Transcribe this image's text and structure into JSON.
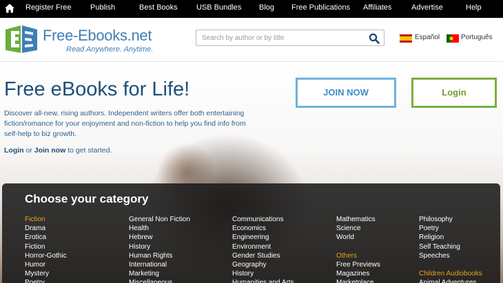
{
  "topnav": {
    "items": [
      "Register Free",
      "Publish",
      "Best Books",
      "USB Bundles",
      "Blog",
      "Free Publications",
      "Affiliates",
      "Advertise",
      "Help"
    ]
  },
  "header": {
    "logo_text": "Free-Ebooks.net",
    "logo_tagline": "Read Anywhere. Anytime.",
    "search_placeholder": "Search by author or by title",
    "languages": [
      "Español",
      "Português"
    ]
  },
  "hero": {
    "title": "Free eBooks for Life!",
    "description": "Discover all-new, rising authors. Independent writers offer both entertaining fiction/romance for your enjoyment and non-fiction to help you find info from self-help to biz growth.",
    "cta_login": "Login",
    "cta_or": " or ",
    "cta_join": "Join now",
    "cta_rest": " to get started.",
    "join_button": "JOIN NOW",
    "login_button": "Login"
  },
  "categories": {
    "heading": "Choose your category",
    "col1": [
      {
        "text": "Fiction",
        "heading": true
      },
      {
        "text": "Drama"
      },
      {
        "text": "Erotica"
      },
      {
        "text": "Fiction"
      },
      {
        "text": "Horror-Gothic"
      },
      {
        "text": "Humor"
      },
      {
        "text": "Mystery"
      },
      {
        "text": "Poetry"
      }
    ],
    "col2": [
      {
        "text": "General Non Fiction"
      },
      {
        "text": "Health"
      },
      {
        "text": "Hebrew"
      },
      {
        "text": "History"
      },
      {
        "text": "Human Rights"
      },
      {
        "text": "International"
      },
      {
        "text": "Marketing"
      },
      {
        "text": "Miscellaneous"
      }
    ],
    "col3": [
      {
        "text": "Communications"
      },
      {
        "text": "Economics"
      },
      {
        "text": "Engineering"
      },
      {
        "text": "Environment"
      },
      {
        "text": "Gender Studies"
      },
      {
        "text": "Geography"
      },
      {
        "text": "History"
      },
      {
        "text": "Humanities and Arts"
      }
    ],
    "col4": [
      {
        "text": "Mathematics"
      },
      {
        "text": "Science"
      },
      {
        "text": "World"
      },
      {
        "text": ""
      },
      {
        "text": "Others",
        "heading": true
      },
      {
        "text": "Free Previews"
      },
      {
        "text": "Magazines"
      },
      {
        "text": "Marketplace"
      }
    ],
    "col5": [
      {
        "text": "Philosophy"
      },
      {
        "text": "Poetry"
      },
      {
        "text": "Religion"
      },
      {
        "text": "Self Teaching"
      },
      {
        "text": "Speeches"
      },
      {
        "text": ""
      },
      {
        "text": "Children Audiobooks",
        "heading": true
      },
      {
        "text": "Animal Adventures"
      }
    ]
  },
  "colors": {
    "topnav_bg": "#000000",
    "brand_blue": "#1f4e79",
    "join_border": "#6fb2df",
    "login_border": "#7aae3f",
    "category_heading": "#e6a21c"
  },
  "icons": [
    "home-icon",
    "logo-icon",
    "search-icon",
    "spain-flag-icon",
    "portugal-flag-icon"
  ]
}
